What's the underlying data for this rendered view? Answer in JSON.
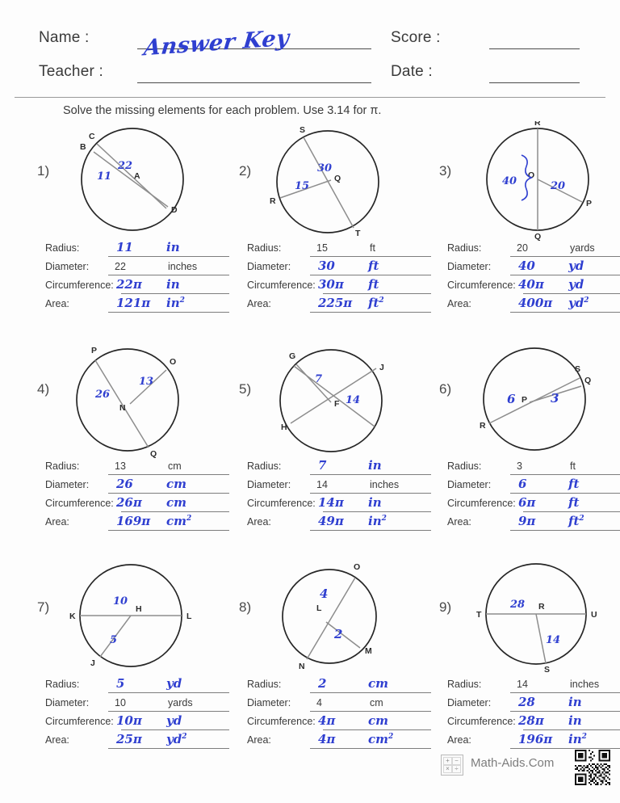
{
  "header": {
    "name_label": "Name :",
    "name_value": "Answer Key",
    "teacher_label": "Teacher :",
    "teacher_value": "",
    "score_label": "Score :",
    "score_value": "",
    "date_label": "Date :",
    "date_value": ""
  },
  "instructions": "Solve the missing elements for each problem. Use 3.14 for π.",
  "labels": {
    "radius": "Radius:",
    "diameter": "Diameter:",
    "circumference": "Circumference:",
    "area": "Area:"
  },
  "problems": [
    {
      "number": "1)",
      "points": [
        "C",
        "B",
        "A",
        "D"
      ],
      "figure_annotations": [
        "22",
        "11"
      ],
      "radius_value": "11",
      "radius_unit": "in",
      "radius_hw": true,
      "diameter_value": "22",
      "diameter_unit": "inches",
      "diameter_hw": false,
      "circumference_value": "22π",
      "circumference_unit": "in",
      "circumference_hw": true,
      "area_value": "121π",
      "area_unit": "in",
      "area_exp": "2",
      "area_hw": true
    },
    {
      "number": "2)",
      "points": [
        "S",
        "Q",
        "R",
        "T"
      ],
      "figure_annotations": [
        "30",
        "15"
      ],
      "radius_value": "15",
      "radius_unit": "ft",
      "radius_hw": false,
      "diameter_value": "30",
      "diameter_unit": "ft",
      "diameter_hw": true,
      "circumference_value": "30π",
      "circumference_unit": "ft",
      "circumference_hw": true,
      "area_value": "225π",
      "area_unit": "ft",
      "area_exp": "2",
      "area_hw": true
    },
    {
      "number": "3)",
      "points": [
        "R",
        "O",
        "P",
        "Q"
      ],
      "figure_annotations": [
        "40",
        "20"
      ],
      "radius_value": "20",
      "radius_unit": "yards",
      "radius_hw": false,
      "diameter_value": "40",
      "diameter_unit": "yd",
      "diameter_hw": true,
      "circumference_value": "40π",
      "circumference_unit": "yd",
      "circumference_hw": true,
      "area_value": "400π",
      "area_unit": "yd",
      "area_exp": "2",
      "area_hw": true
    },
    {
      "number": "4)",
      "points": [
        "P",
        "O",
        "N",
        "Q"
      ],
      "figure_annotations": [
        "13",
        "26"
      ],
      "radius_value": "13",
      "radius_unit": "cm",
      "radius_hw": false,
      "diameter_value": "26",
      "diameter_unit": "cm",
      "diameter_hw": true,
      "circumference_value": "26π",
      "circumference_unit": "cm",
      "circumference_hw": true,
      "area_value": "169π",
      "area_unit": "cm",
      "area_exp": "2",
      "area_hw": true
    },
    {
      "number": "5)",
      "points": [
        "G",
        "J",
        "F",
        "H"
      ],
      "figure_annotations": [
        "7",
        "14"
      ],
      "radius_value": "7",
      "radius_unit": "in",
      "radius_hw": true,
      "diameter_value": "14",
      "diameter_unit": "inches",
      "diameter_hw": false,
      "circumference_value": "14π",
      "circumference_unit": "in",
      "circumference_hw": true,
      "area_value": "49π",
      "area_unit": "in",
      "area_exp": "2",
      "area_hw": true
    },
    {
      "number": "6)",
      "points": [
        "S",
        "Q",
        "P",
        "R"
      ],
      "figure_annotations": [
        "6",
        "3"
      ],
      "radius_value": "3",
      "radius_unit": "ft",
      "radius_hw": false,
      "diameter_value": "6",
      "diameter_unit": "ft",
      "diameter_hw": true,
      "circumference_value": "6π",
      "circumference_unit": "ft",
      "circumference_hw": true,
      "area_value": "9π",
      "area_unit": "ft",
      "area_exp": "2",
      "area_hw": true
    },
    {
      "number": "7)",
      "points": [
        "K",
        "H",
        "L",
        "J"
      ],
      "figure_annotations": [
        "10",
        "5"
      ],
      "radius_value": "5",
      "radius_unit": "yd",
      "radius_hw": true,
      "diameter_value": "10",
      "diameter_unit": "yards",
      "diameter_hw": false,
      "circumference_value": "10π",
      "circumference_unit": "yd",
      "circumference_hw": true,
      "area_value": "25π",
      "area_unit": "yd",
      "area_exp": "2",
      "area_hw": true
    },
    {
      "number": "8)",
      "points": [
        "O",
        "L",
        "M",
        "N"
      ],
      "figure_annotations": [
        "4",
        "2"
      ],
      "radius_value": "2",
      "radius_unit": "cm",
      "radius_hw": true,
      "diameter_value": "4",
      "diameter_unit": "cm",
      "diameter_hw": false,
      "circumference_value": "4π",
      "circumference_unit": "cm",
      "circumference_hw": true,
      "area_value": "4π",
      "area_unit": "cm",
      "area_exp": "2",
      "area_hw": true
    },
    {
      "number": "9)",
      "points": [
        "T",
        "R",
        "U",
        "S"
      ],
      "figure_annotations": [
        "28",
        "14"
      ],
      "radius_value": "14",
      "radius_unit": "inches",
      "radius_hw": false,
      "diameter_value": "28",
      "diameter_unit": "in",
      "diameter_hw": true,
      "circumference_value": "28π",
      "circumference_unit": "in",
      "circumference_hw": true,
      "area_value": "196π",
      "area_unit": "in",
      "area_exp": "2",
      "area_hw": true
    }
  ],
  "footer": {
    "brand": "Math-Aids.Com",
    "logo_symbols": [
      "+",
      "−",
      "×",
      "÷"
    ]
  },
  "colors": {
    "handwriting": "#2f3fd0",
    "print": "#3a3a3a",
    "circle_stroke": "#262626",
    "chord_stroke": "#8d8d8d"
  }
}
